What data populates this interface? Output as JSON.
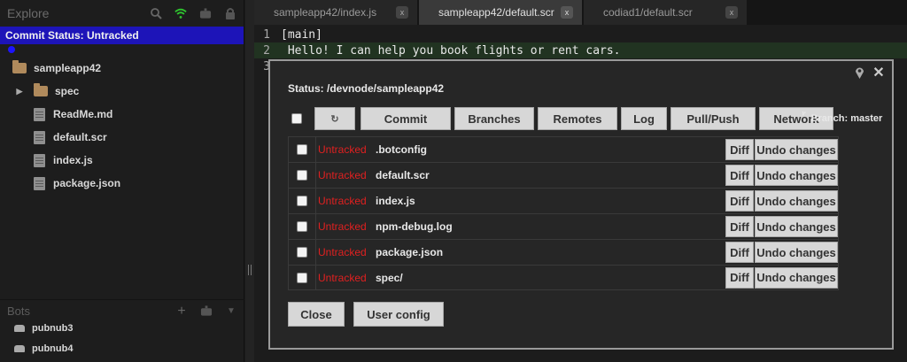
{
  "sidebar": {
    "title": "Explore",
    "commit_status": "Commit Status: Untracked",
    "tree": [
      {
        "label": "sampleapp42",
        "kind": "folder",
        "indent": 0
      },
      {
        "label": "spec",
        "kind": "folder",
        "indent": 1,
        "arrow": "▶"
      },
      {
        "label": "ReadMe.md",
        "kind": "file",
        "indent": 1
      },
      {
        "label": "default.scr",
        "kind": "file",
        "indent": 1
      },
      {
        "label": "index.js",
        "kind": "file",
        "indent": 1
      },
      {
        "label": "package.json",
        "kind": "file",
        "indent": 1
      }
    ],
    "bots_title": "Bots",
    "bots": [
      "pubnub3",
      "pubnub4"
    ]
  },
  "editor": {
    "tabs": [
      {
        "dir": "sampleapp42/",
        "file": "index.js",
        "active": false
      },
      {
        "dir": "sampleapp42/",
        "file": "default.scr",
        "active": true
      },
      {
        "dir": "codiad1/",
        "file": "default.scr",
        "active": false
      }
    ],
    "lines": [
      {
        "n": "1",
        "text": "[main]"
      },
      {
        "n": "2",
        "text": " Hello! I can help you book flights or rent cars."
      },
      {
        "n": "3",
        "text": ""
      }
    ]
  },
  "git": {
    "status": "Status: /devnode/sampleapp42",
    "toolbar": {
      "refresh": "↻",
      "commit": "Commit",
      "branches": "Branches",
      "remotes": "Remotes",
      "log": "Log",
      "pullpush": "Pull/Push",
      "network": "Network"
    },
    "branch_icon": "ᵞ",
    "branch": "Branch: master",
    "files": [
      {
        "state": "Untracked",
        "name": ".botconfig"
      },
      {
        "state": "Untracked",
        "name": "default.scr"
      },
      {
        "state": "Untracked",
        "name": "index.js"
      },
      {
        "state": "Untracked",
        "name": "npm-debug.log"
      },
      {
        "state": "Untracked",
        "name": "package.json"
      },
      {
        "state": "Untracked",
        "name": "spec/"
      }
    ],
    "diff_label": "Diff",
    "undo_label": "Undo changes",
    "close_label": "Close",
    "user_config_label": "User config"
  }
}
